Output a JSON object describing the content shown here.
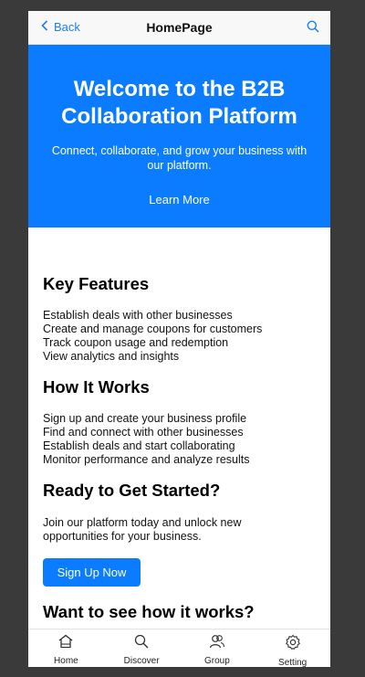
{
  "navbar": {
    "back_label": "Back",
    "title": "HomePage"
  },
  "hero": {
    "title": "Welcome to the B2B Collaboration Platform",
    "subtitle": "Connect, collaborate, and grow your business with our platform.",
    "cta_label": "Learn More"
  },
  "key_features": {
    "title": "Key Features",
    "items": [
      "Establish deals with other businesses",
      "Create and manage coupons for customers",
      "Track coupon usage and redemption",
      "View analytics and insights"
    ]
  },
  "how_it_works": {
    "title": "How It Works",
    "items": [
      "Sign up and create your business profile",
      "Find and connect with other businesses",
      "Establish deals and start collaborating",
      "Monitor performance and analyze results"
    ]
  },
  "get_started": {
    "title": "Ready to Get Started?",
    "text": "Join our platform today and unlock new opportunities for your business.",
    "button_label": "Sign Up Now"
  },
  "see_how": {
    "title": "Want to see how it works?"
  },
  "tabs": [
    {
      "label": "Home",
      "icon": "home-icon"
    },
    {
      "label": "Discover",
      "icon": "search-icon"
    },
    {
      "label": "Group",
      "icon": "group-icon"
    },
    {
      "label": "Setting",
      "icon": "gear-icon"
    }
  ],
  "colors": {
    "accent": "#0b7cff",
    "link": "#1a7df5",
    "background": "#3a3a3a"
  }
}
